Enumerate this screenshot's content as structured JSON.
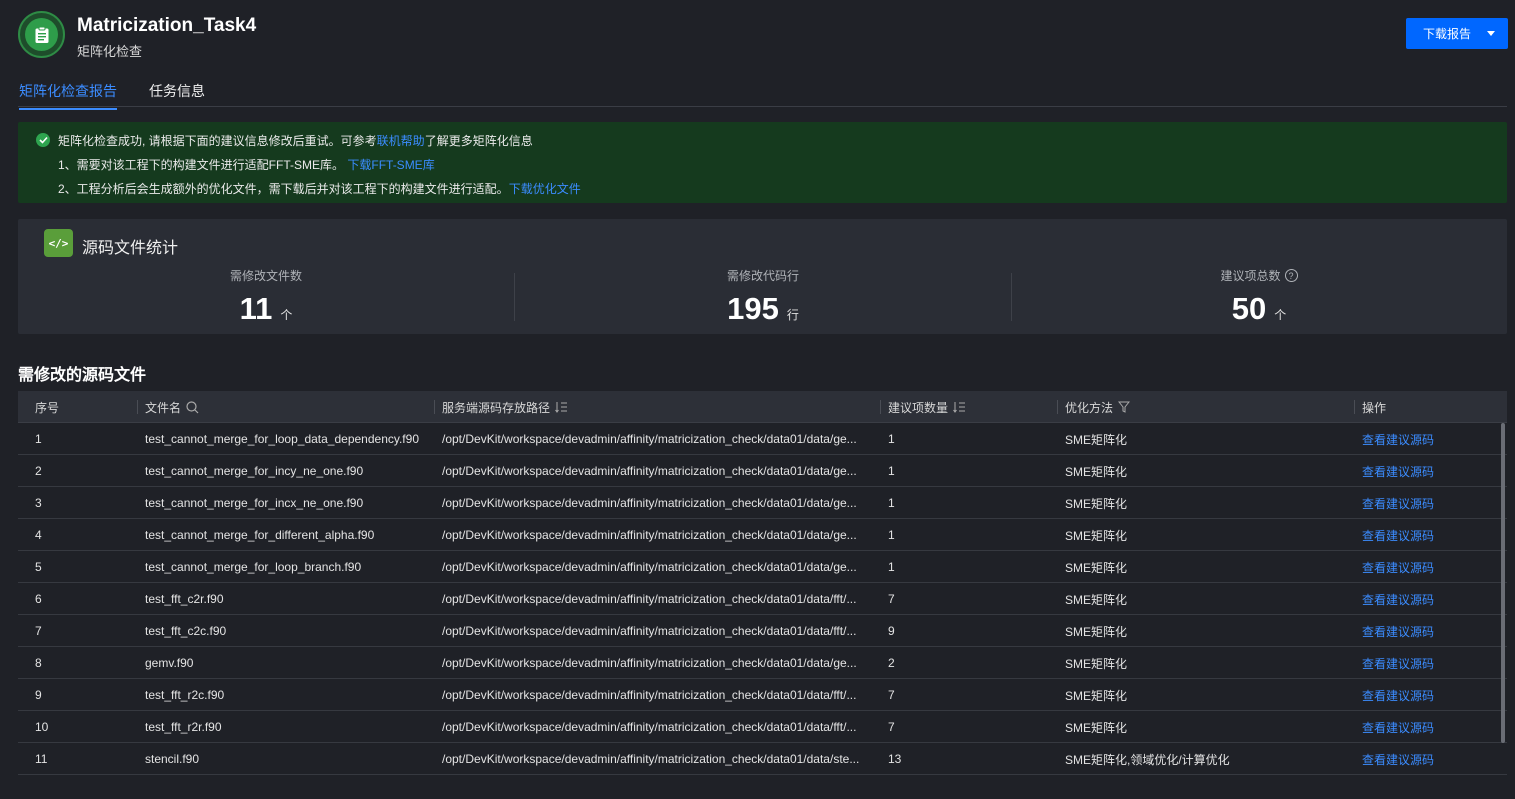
{
  "header": {
    "title": "Matricization_Task4",
    "subtitle": "矩阵化检查",
    "download_label": "下载报告"
  },
  "tabs": [
    {
      "label": "矩阵化检查报告",
      "active": true
    },
    {
      "label": "任务信息",
      "active": false
    }
  ],
  "alert": {
    "line1_text": "矩阵化检查成功, 请根据下面的建议信息修改后重试。可参考",
    "line1_link": "联机帮助",
    "line1_suffix": "了解更多矩阵化信息",
    "line2_text": "1、需要对该工程下的构建文件进行适配FFT-SME库。",
    "line2_link": "下载FFT-SME库",
    "line3_text": "2、工程分析后会生成额外的优化文件，需下载后并对该工程下的构建文件进行适配。",
    "line3_link": "下载优化文件"
  },
  "stats": {
    "title": "源码文件统计",
    "items": [
      {
        "label": "需修改文件数",
        "value": "11",
        "unit": "个"
      },
      {
        "label": "需修改代码行",
        "value": "195",
        "unit": "行"
      },
      {
        "label": "建议项总数",
        "value": "50",
        "unit": "个"
      }
    ]
  },
  "table": {
    "title": "需修改的源码文件",
    "headers": {
      "index": "序号",
      "file": "文件名",
      "path": "服务端源码存放路径",
      "count": "建议项数量",
      "method": "优化方法",
      "action": "操作"
    },
    "action_label": "查看建议源码",
    "rows": [
      {
        "index": "1",
        "file": "test_cannot_merge_for_loop_data_dependency.f90",
        "path": "/opt/DevKit/workspace/devadmin/affinity/matricization_check/data01/data/ge...",
        "count": "1",
        "method": "SME矩阵化"
      },
      {
        "index": "2",
        "file": "test_cannot_merge_for_incy_ne_one.f90",
        "path": "/opt/DevKit/workspace/devadmin/affinity/matricization_check/data01/data/ge...",
        "count": "1",
        "method": "SME矩阵化"
      },
      {
        "index": "3",
        "file": "test_cannot_merge_for_incx_ne_one.f90",
        "path": "/opt/DevKit/workspace/devadmin/affinity/matricization_check/data01/data/ge...",
        "count": "1",
        "method": "SME矩阵化"
      },
      {
        "index": "4",
        "file": "test_cannot_merge_for_different_alpha.f90",
        "path": "/opt/DevKit/workspace/devadmin/affinity/matricization_check/data01/data/ge...",
        "count": "1",
        "method": "SME矩阵化"
      },
      {
        "index": "5",
        "file": "test_cannot_merge_for_loop_branch.f90",
        "path": "/opt/DevKit/workspace/devadmin/affinity/matricization_check/data01/data/ge...",
        "count": "1",
        "method": "SME矩阵化"
      },
      {
        "index": "6",
        "file": "test_fft_c2r.f90",
        "path": "/opt/DevKit/workspace/devadmin/affinity/matricization_check/data01/data/fft/...",
        "count": "7",
        "method": "SME矩阵化"
      },
      {
        "index": "7",
        "file": "test_fft_c2c.f90",
        "path": "/opt/DevKit/workspace/devadmin/affinity/matricization_check/data01/data/fft/...",
        "count": "9",
        "method": "SME矩阵化"
      },
      {
        "index": "8",
        "file": "gemv.f90",
        "path": "/opt/DevKit/workspace/devadmin/affinity/matricization_check/data01/data/ge...",
        "count": "2",
        "method": "SME矩阵化"
      },
      {
        "index": "9",
        "file": "test_fft_r2c.f90",
        "path": "/opt/DevKit/workspace/devadmin/affinity/matricization_check/data01/data/fft/...",
        "count": "7",
        "method": "SME矩阵化"
      },
      {
        "index": "10",
        "file": "test_fft_r2r.f90",
        "path": "/opt/DevKit/workspace/devadmin/affinity/matricization_check/data01/data/fft/...",
        "count": "7",
        "method": "SME矩阵化"
      },
      {
        "index": "11",
        "file": "stencil.f90",
        "path": "/opt/DevKit/workspace/devadmin/affinity/matricization_check/data01/data/ste...",
        "count": "13",
        "method": "SME矩阵化,领域优化/计算优化"
      }
    ]
  },
  "colors": {
    "accent": "#0067ff",
    "link": "#3b8cff",
    "success_bg": "#153a1e",
    "success_icon": "#2ea44f"
  }
}
